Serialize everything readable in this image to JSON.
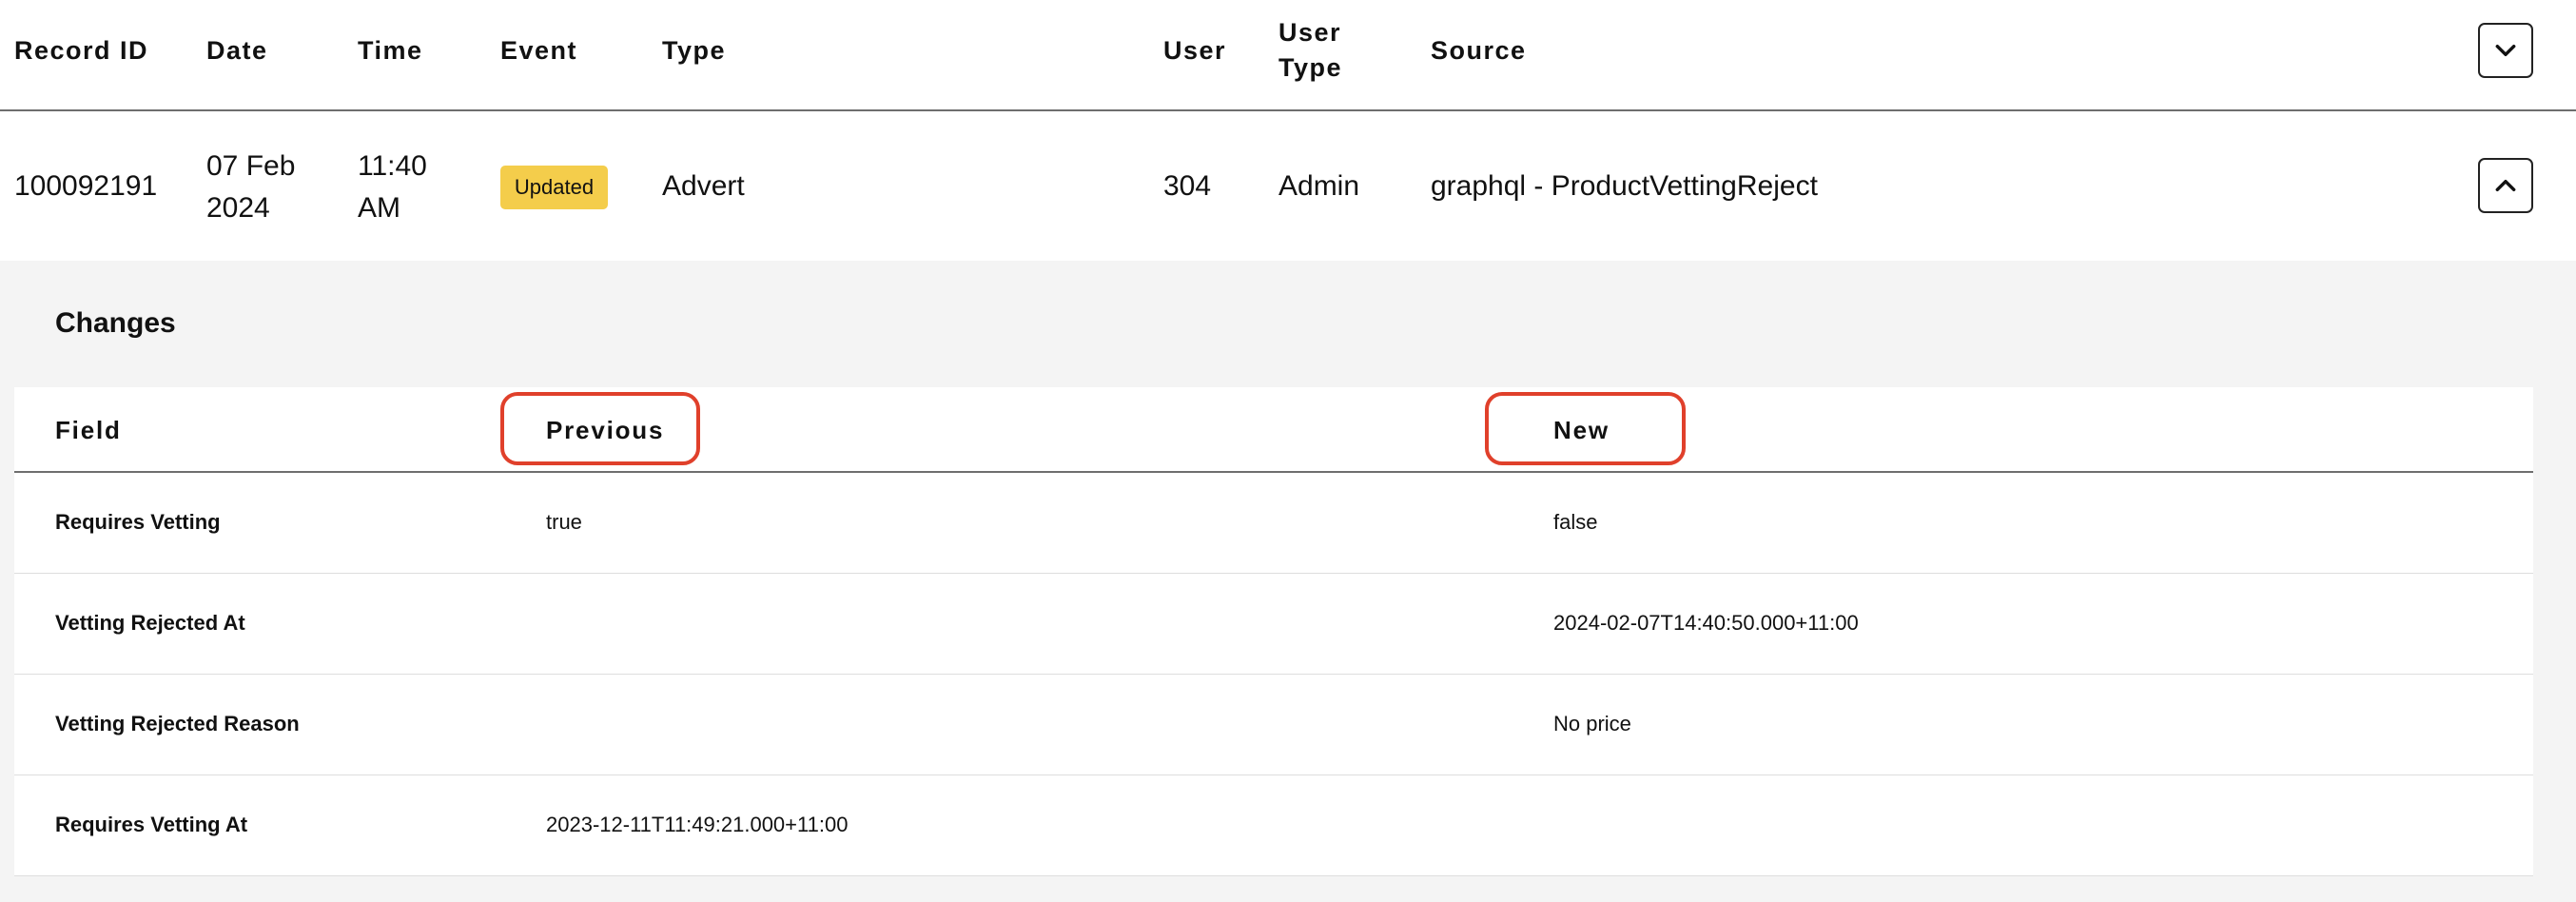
{
  "header": {
    "columns": [
      "Record ID",
      "Date",
      "Time",
      "Event",
      "Type",
      "User",
      "User\nType",
      "Source"
    ],
    "user_type_line1": "User",
    "user_type_line2": "Type",
    "expand_icon": "chevron-down-icon"
  },
  "record": {
    "record_id": "100092191",
    "date_line1": "07 Feb",
    "date_line2": "2024",
    "time_line1": "11:40",
    "time_line2": "AM",
    "event": "Updated",
    "type": "Advert",
    "user": "304",
    "user_type": "Admin",
    "source": "graphql - ProductVettingReject",
    "collapse_icon": "chevron-up-icon",
    "badge_color": "#f4cd4b"
  },
  "changes": {
    "title": "Changes",
    "headers": {
      "field": "Field",
      "previous": "Previous",
      "new": "New"
    },
    "rows": [
      {
        "field": "Requires Vetting",
        "previous": "true",
        "new": "false"
      },
      {
        "field": "Vetting Rejected At",
        "previous": "",
        "new": "2024-02-07T14:40:50.000+11:00"
      },
      {
        "field": "Vetting Rejected Reason",
        "previous": "",
        "new": "No price"
      },
      {
        "field": "Requires Vetting At",
        "previous": "2023-12-11T11:49:21.000+11:00",
        "new": ""
      }
    ]
  },
  "annotation_color": "#e0402b"
}
